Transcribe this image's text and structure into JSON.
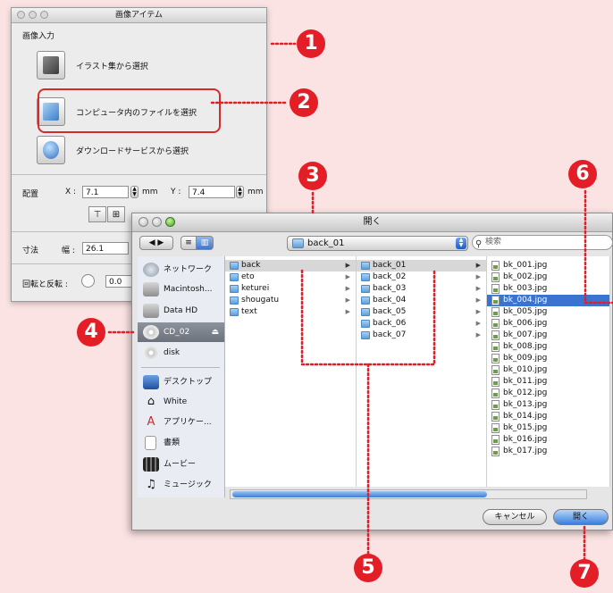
{
  "panel": {
    "title": "画像アイテム",
    "section": "画像入力",
    "sources": [
      {
        "label": "イラスト集から選択"
      },
      {
        "label": "コンピュータ内のファイルを選択"
      },
      {
        "label": "ダウンロードサービスから選択"
      }
    ],
    "placement": {
      "label": "配置",
      "x_label": "X :",
      "x_value": "7.1",
      "x_unit": "mm",
      "y_label": "Y :",
      "y_value": "7.4",
      "y_unit": "mm"
    },
    "size": {
      "label": "寸法",
      "w_label": "幅 :",
      "w_value": "26.1"
    },
    "rotate": {
      "label": "回転と反転 :",
      "value": "0.0"
    }
  },
  "dialog": {
    "title": "開く",
    "view_list_icon": "≡",
    "view_column_icon": "▥",
    "path_label": "back_01",
    "search_placeholder": "検索",
    "sidebar": [
      {
        "label": "ネットワーク",
        "icon": "network-icon"
      },
      {
        "label": "Macintosh...",
        "icon": "hard-disk-icon"
      },
      {
        "label": "Data HD",
        "icon": "hard-disk-icon"
      },
      {
        "label": "CD_02",
        "icon": "cd-icon"
      },
      {
        "label": "disk",
        "icon": "disk-icon"
      },
      {
        "label": "デスクトップ",
        "icon": "desktop-icon"
      },
      {
        "label": "White",
        "icon": "home-icon"
      },
      {
        "label": "アプリケー...",
        "icon": "applications-icon"
      },
      {
        "label": "書類",
        "icon": "documents-icon"
      },
      {
        "label": "ムービー",
        "icon": "movies-icon"
      },
      {
        "label": "ミュージック",
        "icon": "music-icon"
      }
    ],
    "column1": [
      "back",
      "eto",
      "keturei",
      "shougatu",
      "text"
    ],
    "column2": [
      "back_01",
      "back_02",
      "back_03",
      "back_04",
      "back_05",
      "back_06",
      "back_07"
    ],
    "column3": [
      "bk_001.jpg",
      "bk_002.jpg",
      "bk_003.jpg",
      "bk_004.jpg",
      "bk_005.jpg",
      "bk_006.jpg",
      "bk_007.jpg",
      "bk_008.jpg",
      "bk_009.jpg",
      "bk_010.jpg",
      "bk_011.jpg",
      "bk_012.jpg",
      "bk_013.jpg",
      "bk_014.jpg",
      "bk_015.jpg",
      "bk_016.jpg",
      "bk_017.jpg"
    ],
    "cancel_label": "キャンセル",
    "open_label": "開く"
  },
  "callouts": [
    "1",
    "2",
    "3",
    "4",
    "5",
    "6",
    "7"
  ],
  "colors": {
    "callout": "#e41e26",
    "selection": "#3b73d1"
  }
}
